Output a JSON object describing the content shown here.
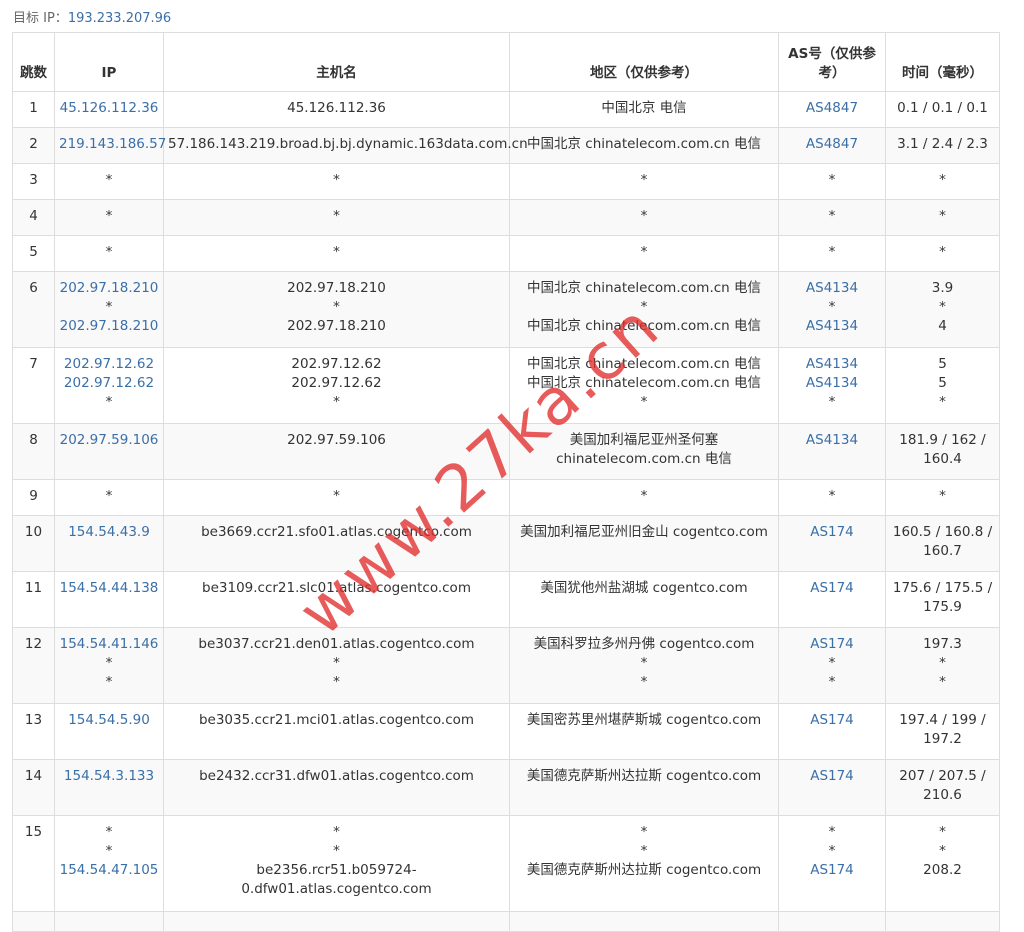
{
  "target": {
    "label": "目标 IP：",
    "ip": "193.233.207.96"
  },
  "headers": {
    "hop": "跳数",
    "ip": "IP",
    "host": "主机名",
    "region": "地区（仅供参考）",
    "as": "AS号（仅供参考）",
    "time": "时间（毫秒）"
  },
  "rows": [
    {
      "hop": "1",
      "h": 36,
      "ip": [
        "45.126.112.36"
      ],
      "host": [
        "45.126.112.36"
      ],
      "region": [
        "中国北京 电信"
      ],
      "as": [
        "AS4847"
      ],
      "time": [
        "0.1 / 0.1 / 0.1"
      ]
    },
    {
      "hop": "2",
      "h": 36,
      "ip": [
        "219.143.186.57"
      ],
      "host": [
        "57.186.143.219.broad.bj.bj.dynamic.163data.com.cn"
      ],
      "region": [
        "中国北京 chinatelecom.com.cn 电信"
      ],
      "as": [
        "AS4847"
      ],
      "time": [
        "3.1 / 2.4 / 2.3"
      ]
    },
    {
      "hop": "3",
      "h": 36,
      "ip": [
        "*"
      ],
      "host": [
        "*"
      ],
      "region": [
        "*"
      ],
      "as": [
        "*"
      ],
      "time": [
        "*"
      ]
    },
    {
      "hop": "4",
      "h": 36,
      "ip": [
        "*"
      ],
      "host": [
        "*"
      ],
      "region": [
        "*"
      ],
      "as": [
        "*"
      ],
      "time": [
        "*"
      ]
    },
    {
      "hop": "5",
      "h": 36,
      "ip": [
        "*"
      ],
      "host": [
        "*"
      ],
      "region": [
        "*"
      ],
      "as": [
        "*"
      ],
      "time": [
        "*"
      ]
    },
    {
      "hop": "6",
      "h": 76,
      "ip": [
        "202.97.18.210",
        "*",
        "202.97.18.210"
      ],
      "host": [
        "202.97.18.210",
        "*",
        "202.97.18.210"
      ],
      "region": [
        "中国北京 chinatelecom.com.cn 电信",
        "*",
        "中国北京 chinatelecom.com.cn 电信"
      ],
      "as": [
        "AS4134",
        "*",
        "AS4134"
      ],
      "time": [
        "3.9",
        "*",
        "4"
      ]
    },
    {
      "hop": "7",
      "h": 76,
      "ip": [
        "202.97.12.62",
        "202.97.12.62",
        "*"
      ],
      "host": [
        "202.97.12.62",
        "202.97.12.62",
        "*"
      ],
      "region": [
        "中国北京 chinatelecom.com.cn 电信",
        "中国北京 chinatelecom.com.cn 电信",
        "*"
      ],
      "as": [
        "AS4134",
        "AS4134",
        "*"
      ],
      "time": [
        "5",
        "5",
        "*"
      ]
    },
    {
      "hop": "8",
      "h": 56,
      "ip": [
        "202.97.59.106"
      ],
      "host": [
        "202.97.59.106"
      ],
      "region": [
        "美国加利福尼亚州圣何塞",
        "chinatelecom.com.cn 电信"
      ],
      "as": [
        "AS4134"
      ],
      "time": [
        "181.9 / 162 /",
        "160.4"
      ]
    },
    {
      "hop": "9",
      "h": 36,
      "ip": [
        "*"
      ],
      "host": [
        "*"
      ],
      "region": [
        "*"
      ],
      "as": [
        "*"
      ],
      "time": [
        "*"
      ]
    },
    {
      "hop": "10",
      "h": 56,
      "ip": [
        "154.54.43.9"
      ],
      "host": [
        "be3669.ccr21.sfo01.atlas.cogentco.com"
      ],
      "region": [
        "美国加利福尼亚州旧金山 cogentco.com"
      ],
      "as": [
        "AS174"
      ],
      "time": [
        "160.5 / 160.8 /",
        "160.7"
      ]
    },
    {
      "hop": "11",
      "h": 56,
      "ip": [
        "154.54.44.138"
      ],
      "host": [
        "be3109.ccr21.slc01.atlas.cogentco.com"
      ],
      "region": [
        "美国犹他州盐湖城 cogentco.com"
      ],
      "as": [
        "AS174"
      ],
      "time": [
        "175.6 / 175.5 /",
        "175.9"
      ]
    },
    {
      "hop": "12",
      "h": 76,
      "ip": [
        "154.54.41.146",
        "*",
        "*"
      ],
      "host": [
        "be3037.ccr21.den01.atlas.cogentco.com",
        "*",
        "*"
      ],
      "region": [
        "美国科罗拉多州丹佛 cogentco.com",
        "*",
        "*"
      ],
      "as": [
        "AS174",
        "*",
        "*"
      ],
      "time": [
        "197.3",
        "*",
        "*"
      ]
    },
    {
      "hop": "13",
      "h": 56,
      "ip": [
        "154.54.5.90"
      ],
      "host": [
        "be3035.ccr21.mci01.atlas.cogentco.com"
      ],
      "region": [
        "美国密苏里州堪萨斯城 cogentco.com"
      ],
      "as": [
        "AS174"
      ],
      "time": [
        "197.4 / 199 /",
        "197.2"
      ]
    },
    {
      "hop": "14",
      "h": 56,
      "ip": [
        "154.54.3.133"
      ],
      "host": [
        "be2432.ccr31.dfw01.atlas.cogentco.com"
      ],
      "region": [
        "美国德克萨斯州达拉斯 cogentco.com"
      ],
      "as": [
        "AS174"
      ],
      "time": [
        "207 / 207.5 /",
        "210.6"
      ]
    },
    {
      "hop": "15",
      "h": 96,
      "ip": [
        "*",
        "*",
        "154.54.47.105"
      ],
      "host": [
        "*",
        "*",
        "be2356.rcr51.b059724-",
        "0.dfw01.atlas.cogentco.com"
      ],
      "region": [
        "*",
        "*",
        "美国德克萨斯州达拉斯 cogentco.com"
      ],
      "as": [
        "*",
        "*",
        "AS174"
      ],
      "time": [
        "*",
        "*",
        "208.2"
      ]
    },
    {
      "hop": "",
      "h": 20,
      "ip": [],
      "host": [],
      "region": [],
      "as": [],
      "time": []
    }
  ],
  "watermark": "www.27ka.cn",
  "colors": {
    "link": "#3a6fa8",
    "border": "#dddddd",
    "stripe": "#f9f9f9",
    "watermark": "#e22d2d"
  }
}
